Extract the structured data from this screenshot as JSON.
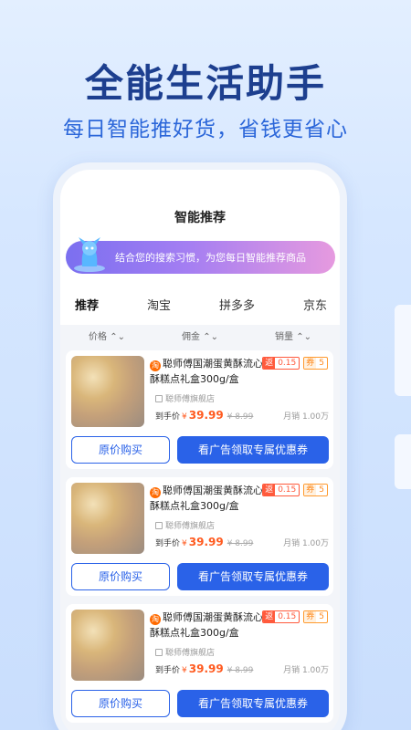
{
  "hero": {
    "title": "全能生活助手",
    "subtitle": "每日智能推好货，省钱更省心"
  },
  "screen": {
    "title": "智能推荐",
    "banner_text": "结合您的搜索习惯，为您每日智能推荐商品"
  },
  "tabs": [
    {
      "label": "推荐",
      "active": true
    },
    {
      "label": "淘宝",
      "active": false
    },
    {
      "label": "拼多多",
      "active": false
    },
    {
      "label": "京东",
      "active": false
    }
  ],
  "sort": [
    {
      "label": "价格 ⌃⌄"
    },
    {
      "label": "佣金 ⌃⌄"
    },
    {
      "label": "销量 ⌃⌄"
    }
  ],
  "products": [
    {
      "platform_badge": "淘",
      "title": "聪师傅国潮蛋黄酥流心酥糕点礼盒300g/盒",
      "rebate_key": "返",
      "rebate_val": "0.15",
      "coupon_key": "券",
      "coupon_val": "5",
      "shop": "聪师傅旗舰店",
      "price_label": "到手价",
      "currency": "¥",
      "price": "39.99",
      "original_price": "¥ 8.99",
      "sales": "月销 1.00万",
      "btn_original": "原价购买",
      "btn_ad": "看广告领取专属优惠券"
    },
    {
      "platform_badge": "淘",
      "title": "聪师傅国潮蛋黄酥流心酥糕点礼盒300g/盒",
      "rebate_key": "返",
      "rebate_val": "0.15",
      "coupon_key": "券",
      "coupon_val": "5",
      "shop": "聪师傅旗舰店",
      "price_label": "到手价",
      "currency": "¥",
      "price": "39.99",
      "original_price": "¥ 8.99",
      "sales": "月销 1.00万",
      "btn_original": "原价购买",
      "btn_ad": "看广告领取专属优惠券"
    },
    {
      "platform_badge": "淘",
      "title": "聪师傅国潮蛋黄酥流心酥糕点礼盒300g/盒",
      "rebate_key": "返",
      "rebate_val": "0.15",
      "coupon_key": "券",
      "coupon_val": "5",
      "shop": "聪师傅旗舰店",
      "price_label": "到手价",
      "currency": "¥",
      "price": "39.99",
      "original_price": "¥ 8.99",
      "sales": "月销 1.00万",
      "btn_original": "原价购买",
      "btn_ad": "看广告领取专属优惠券"
    }
  ],
  "colors": {
    "accent": "#2a62e8",
    "price": "#ff5a1f",
    "hero_title": "#1d3f8f"
  }
}
